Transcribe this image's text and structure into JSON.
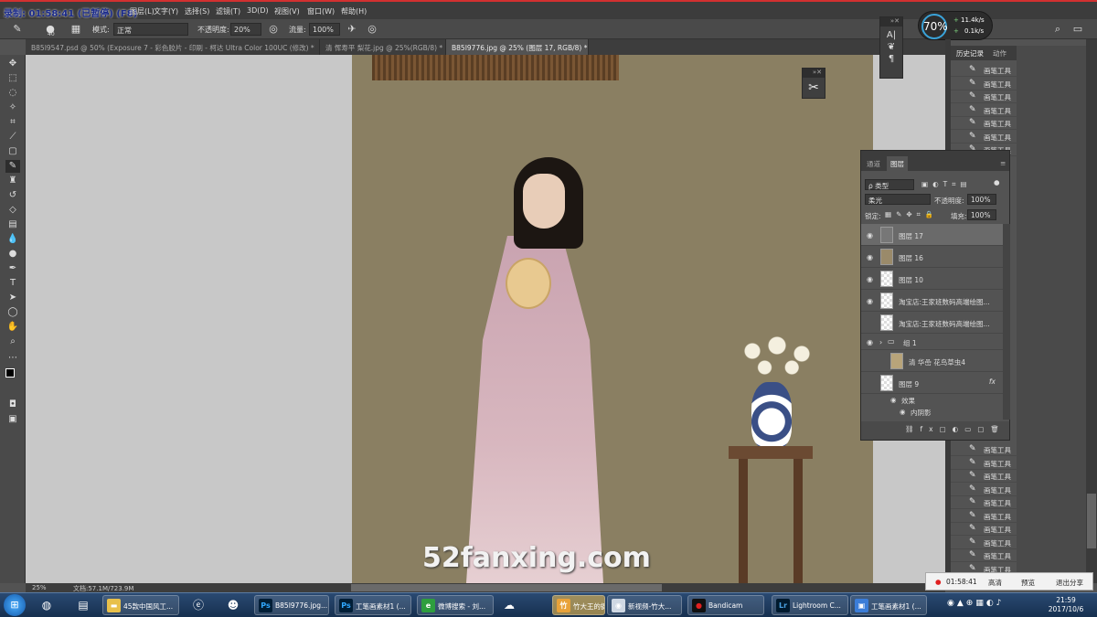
{
  "recorder_title": "录制: 01:58:41 (已暂停) (F8)",
  "menu": [
    "图层(L)",
    "文字(Y)",
    "选择(S)",
    "滤镜(T)",
    "3D(D)",
    "视图(V)",
    "窗口(W)",
    "帮助(H)"
  ],
  "options": {
    "brush_size": "40",
    "mode_label": "模式:",
    "mode_value": "正常",
    "opacity_label": "不透明度:",
    "opacity_value": "20%",
    "flow_label": "流量:",
    "flow_value": "100%"
  },
  "tabs": [
    "B85I9547.psd @ 50% (Exposure 7 - 彩色胶片 - 印刷 - 柯达 Ultra Color 100UC (修改) *",
    "清 恽寿平 梨花.jpg @ 25%(RGB/8) *",
    "B85I9776.jpg @ 25% (图层 17, RGB/8) *"
  ],
  "network": {
    "percent": "70%",
    "upload": "11.4k/s",
    "download": "0.1k/s"
  },
  "history": {
    "tabs": [
      "历史记录",
      "动作"
    ],
    "item_label": "画笔工具"
  },
  "layers": {
    "tabs": [
      "通道",
      "图层"
    ],
    "filter_label": "ρ 类型",
    "blend_mode": "柔光",
    "opacity_label": "不透明度:",
    "opacity_value": "100%",
    "lock_label": "锁定:",
    "fill_label": "填充:",
    "fill_value": "100%",
    "rows": [
      {
        "name": "图层 17",
        "visible": true
      },
      {
        "name": "图层 16",
        "visible": true
      },
      {
        "name": "图层 10",
        "visible": true
      },
      {
        "name": "淘宝店:王家班数码高端绘图...",
        "visible": true
      },
      {
        "name": "淘宝店:王家班数码高端绘图...",
        "visible": false
      },
      {
        "name": "组 1",
        "visible": true
      },
      {
        "name": "清 华嵒 花鸟草虫4",
        "visible": false
      },
      {
        "name": "图层 9",
        "visible": false
      }
    ],
    "effects_label": "效果",
    "inner_shadow_label": "内阴影",
    "fx": "fx"
  },
  "status": {
    "zoom": "25%",
    "doc": "文档:57.1M/723.9M"
  },
  "watermark": "52fanxing.com",
  "recorder_popup": {
    "time": "01:58:41",
    "hd": "高清",
    "preview": "预览",
    "exit_share": "退出分享"
  },
  "taskbar": {
    "apps": [
      {
        "label": "45款中国风工...",
        "icon": "folder"
      },
      {
        "label": "B85I9776.jpg...",
        "icon": "ps"
      },
      {
        "label": "工笔画素材1 (...",
        "icon": "ps"
      },
      {
        "label": "微博搜索 - 刘...",
        "icon": "browser"
      },
      {
        "label": "竹大王的摄影...",
        "icon": "app"
      },
      {
        "label": "新视频-竹大...",
        "icon": "player"
      },
      {
        "label": "Bandicam",
        "icon": "rec"
      },
      {
        "label": "Lightroom C...",
        "icon": "lr"
      },
      {
        "label": "工笔画素材1 (...",
        "icon": "viewer"
      }
    ],
    "time": "21:59",
    "date": "2017/10/6"
  },
  "colors": {
    "accent": "#d23030",
    "ps_blue": "#31a8ff",
    "lr_blue": "#4aa0e0"
  }
}
